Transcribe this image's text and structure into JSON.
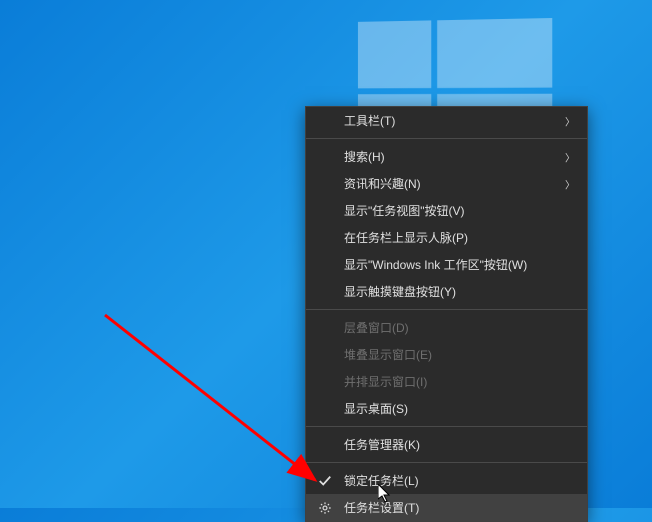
{
  "menu": {
    "items": [
      {
        "label": "工具栏(T)",
        "has_submenu": true
      },
      {
        "label": "搜索(H)",
        "has_submenu": true
      },
      {
        "label": "资讯和兴趣(N)",
        "has_submenu": true
      },
      {
        "label": "显示\"任务视图\"按钮(V)"
      },
      {
        "label": "在任务栏上显示人脉(P)"
      },
      {
        "label": "显示\"Windows Ink 工作区\"按钮(W)"
      },
      {
        "label": "显示触摸键盘按钮(Y)"
      },
      {
        "label": "层叠窗口(D)",
        "disabled": true
      },
      {
        "label": "堆叠显示窗口(E)",
        "disabled": true
      },
      {
        "label": "并排显示窗口(I)",
        "disabled": true
      },
      {
        "label": "显示桌面(S)"
      },
      {
        "label": "任务管理器(K)"
      },
      {
        "label": "锁定任务栏(L)",
        "checked": true
      },
      {
        "label": "任务栏设置(T)",
        "icon": "gear",
        "hover": true
      }
    ]
  },
  "annotation": {
    "color": "#ff0000"
  }
}
